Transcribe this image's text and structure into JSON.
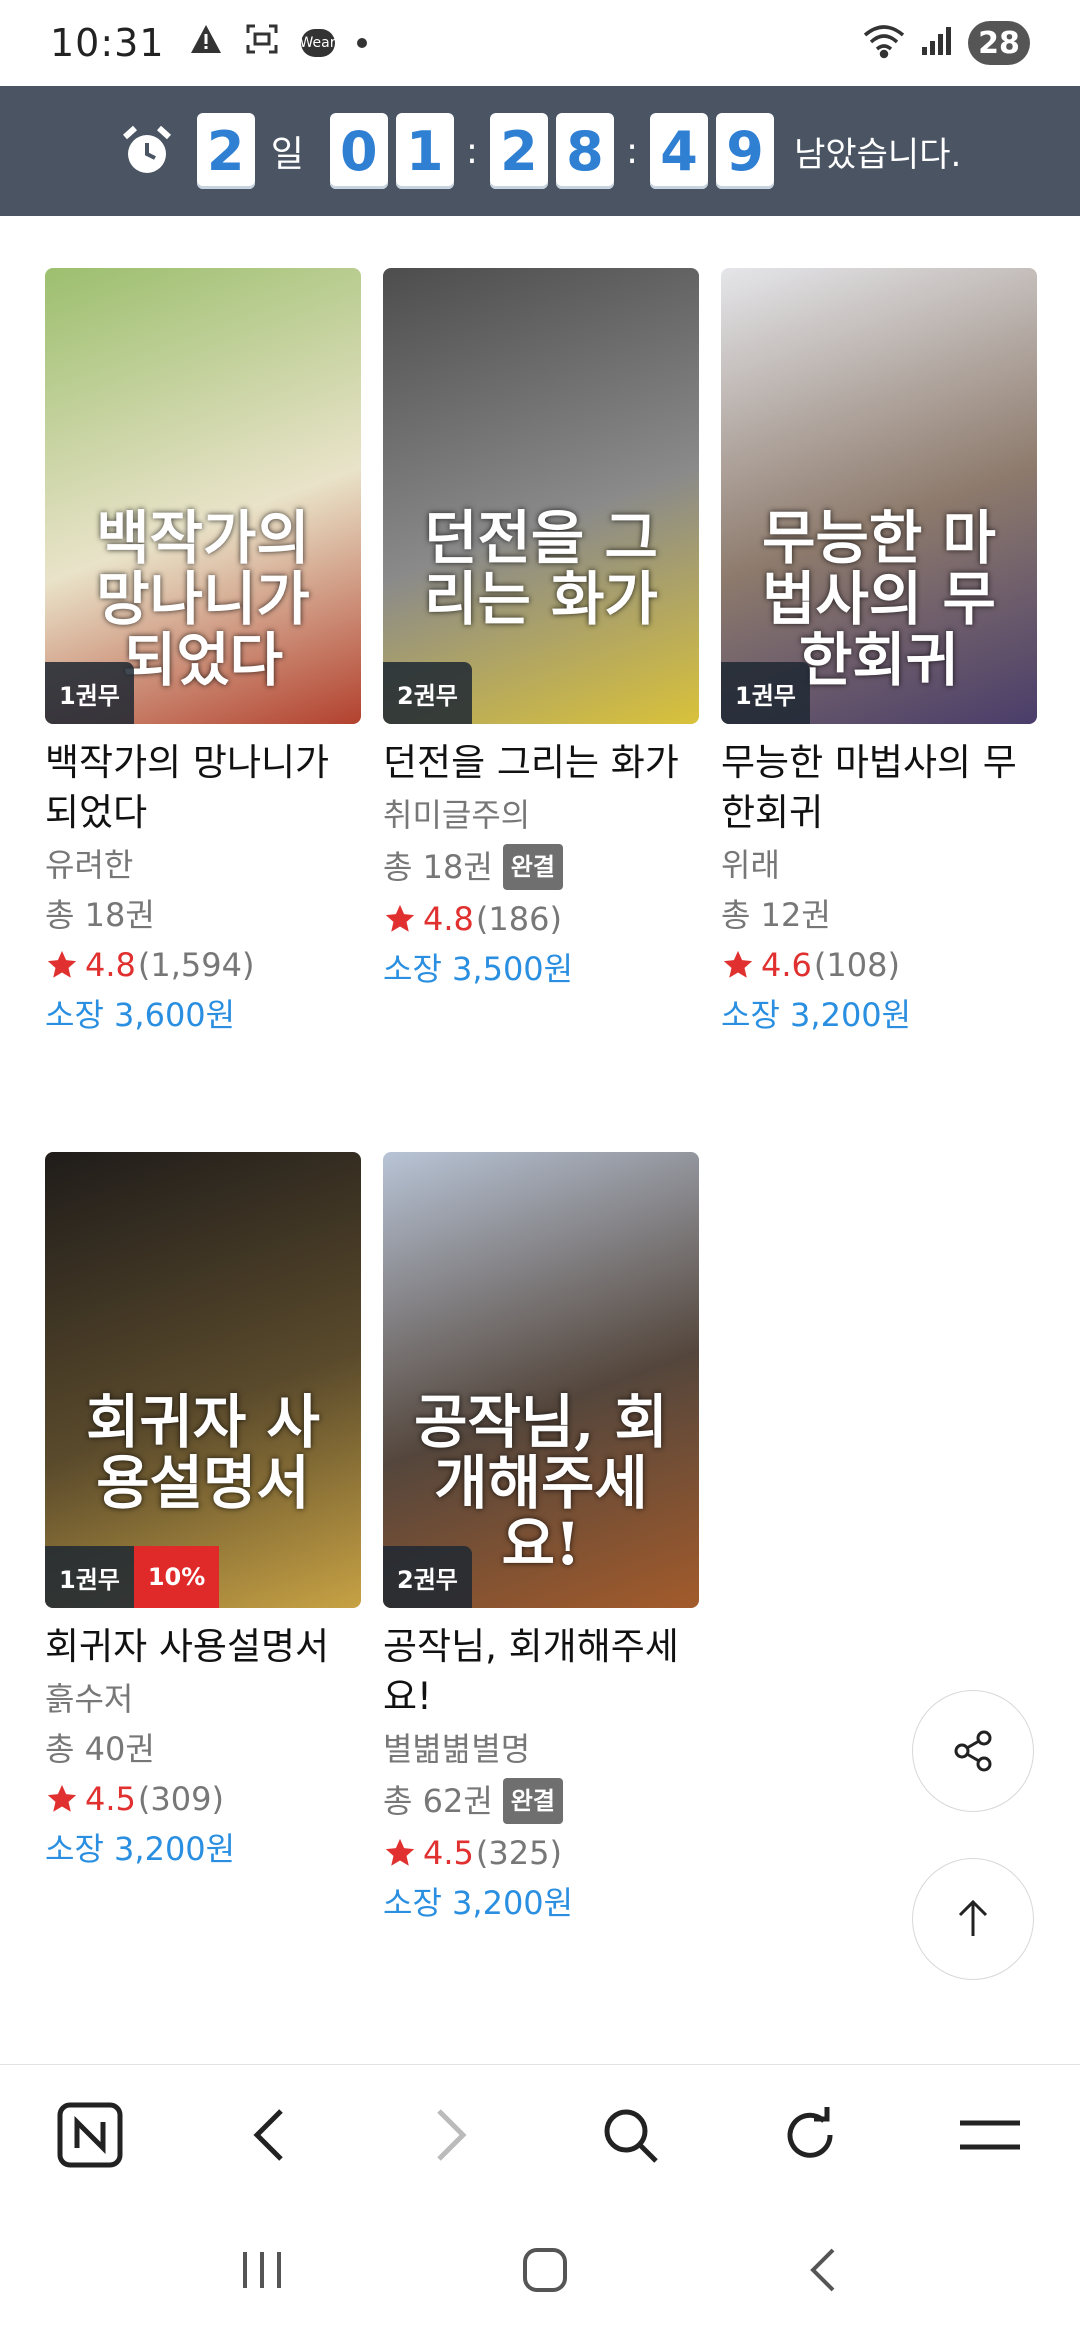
{
  "status_bar": {
    "time": "10:31",
    "battery": "28",
    "wear_label": "Wear"
  },
  "countdown": {
    "days": "2",
    "day_unit": "일",
    "hours": [
      "0",
      "1"
    ],
    "minutes": [
      "2",
      "8"
    ],
    "seconds": [
      "4",
      "9"
    ],
    "colon": ":",
    "tail": "남았습니다."
  },
  "books": [
    {
      "title": "백작가의 망나니가 되었다",
      "cover_text": "백작가의 망나니가 되었다",
      "author": "유려한",
      "volumes": "총 18권",
      "completed": "",
      "rating": "4.8",
      "rating_count": "(1,594)",
      "price": "소장 3,600원",
      "vol_badge": "1권무",
      "discount": "",
      "cover_colors": [
        "#9cbf6e",
        "#e9e3c9",
        "#b2412e"
      ]
    },
    {
      "title": "던전을 그리는 화가",
      "cover_text": "던전을 그리는 화가",
      "author": "취미글주의",
      "volumes": "총 18권",
      "completed": "완결",
      "rating": "4.8",
      "rating_count": "(186)",
      "price": "소장 3,500원",
      "vol_badge": "2권무",
      "discount": "",
      "cover_colors": [
        "#4d4d4d",
        "#8a8a8a",
        "#d9c23a"
      ]
    },
    {
      "title": "무능한 마법사의 무한회귀",
      "cover_text": "무능한 마법사의 무한회귀",
      "author": "위래",
      "volumes": "총 12권",
      "completed": "",
      "rating": "4.6",
      "rating_count": "(108)",
      "price": "소장 3,200원",
      "vol_badge": "1권무",
      "discount": "",
      "cover_colors": [
        "#e5e6ea",
        "#8d7a6c",
        "#4a3d6a"
      ]
    },
    {
      "title": "회귀자 사용설명서",
      "cover_text": "회귀자 사용설명서",
      "author": "흙수저",
      "volumes": "총 40권",
      "completed": "",
      "rating": "4.5",
      "rating_count": "(309)",
      "price": "소장 3,200원",
      "vol_badge": "1권무",
      "discount": "10%",
      "cover_colors": [
        "#1f1c1a",
        "#5a4a2c",
        "#c7a244"
      ]
    },
    {
      "title": "공작님, 회개해주세요!",
      "cover_text": "공작님, 회개해주세요!",
      "author": "별볆볆별명",
      "volumes": "총 62권",
      "completed": "완결",
      "rating": "4.5",
      "rating_count": "(325)",
      "price": "소장 3,200원",
      "vol_badge": "2권무",
      "discount": "",
      "cover_colors": [
        "#b8c4d6",
        "#54463c",
        "#a35b2b"
      ]
    }
  ],
  "accent_colors": {
    "price": "#2a8fe0",
    "rating": "#e0302f",
    "banner": "#4a5463"
  }
}
